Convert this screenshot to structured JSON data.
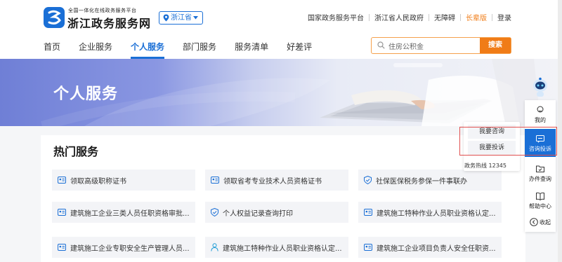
{
  "header": {
    "logo_subtitle": "全国一体化在线政务服务平台",
    "logo_title": "浙江政务服务网",
    "region": "浙江省",
    "top_links": [
      "国家政务服务平台",
      "浙江省人民政府",
      "无障碍",
      "长辈版",
      "登录"
    ]
  },
  "nav": {
    "items": [
      "首页",
      "企业服务",
      "个人服务",
      "部门服务",
      "服务清单",
      "好差评"
    ],
    "active": "个人服务"
  },
  "search": {
    "value": "住房公积金",
    "button": "搜索"
  },
  "banner": {
    "title": "个人服务"
  },
  "hot": {
    "title": "热门服务",
    "items": [
      "领取高级职称证书",
      "领取省考专业技术人员资格证书",
      "社保医保税务参保一件事联办",
      "建筑施工企业三类人员任职资格审批...",
      "个人权益记录查询打印",
      "建筑施工特种作业人员职业资格认定...",
      "建筑施工企业专职安全生产管理人员...",
      "建筑施工特种作业人员职业资格认定...",
      "建筑施工企业项目负责人安全任职资..."
    ]
  },
  "popup": {
    "consult": "我要咨询",
    "complain": "我要投诉",
    "hotline": "政务热线 12345"
  },
  "sidebar": {
    "items": [
      "我的",
      "咨询投诉",
      "办件查询",
      "帮助中心",
      "收起"
    ]
  },
  "colors": {
    "brand_blue": "#1a6fd6",
    "accent_orange": "#f07c17",
    "highlight_red": "#e05050"
  }
}
